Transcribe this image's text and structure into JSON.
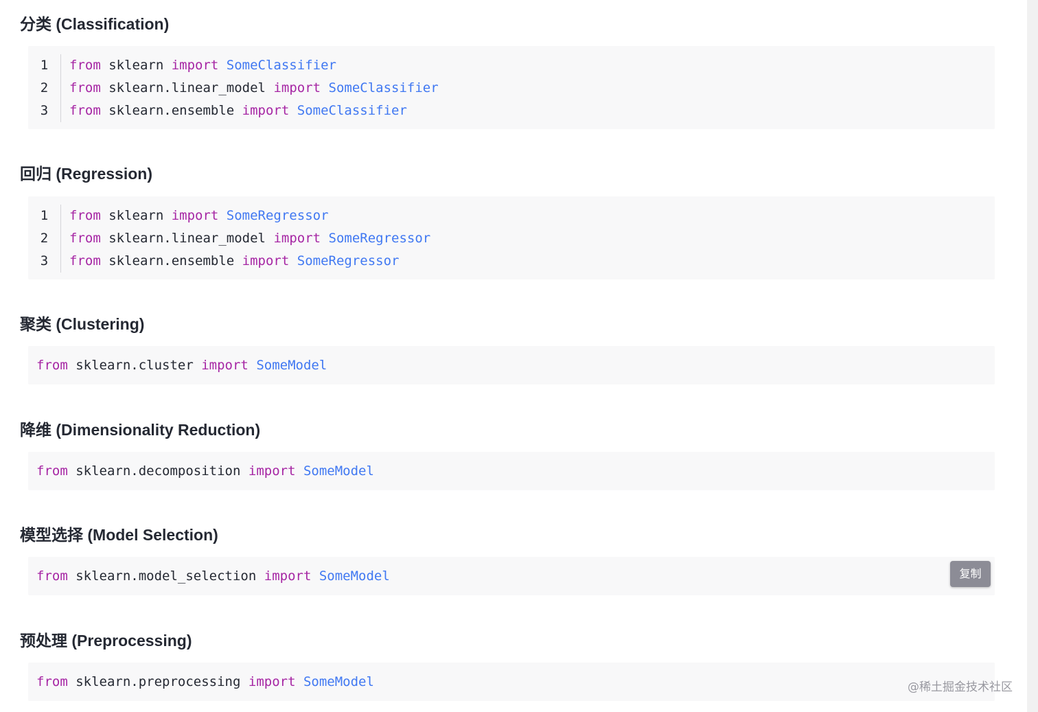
{
  "sections": [
    {
      "heading": "分类 (Classification)",
      "lines": [
        {
          "num": "1",
          "from": "from",
          "module": " sklearn ",
          "import": "import",
          "name": " SomeClassifier"
        },
        {
          "num": "2",
          "from": "from",
          "module": " sklearn.linear_model ",
          "import": "import",
          "name": " SomeClassifier"
        },
        {
          "num": "3",
          "from": "from",
          "module": " sklearn.ensemble ",
          "import": "import",
          "name": " SomeClassifier"
        }
      ]
    },
    {
      "heading": "回归 (Regression)",
      "lines": [
        {
          "num": "1",
          "from": "from",
          "module": " sklearn ",
          "import": "import",
          "name": " SomeRegressor"
        },
        {
          "num": "2",
          "from": "from",
          "module": " sklearn.linear_model ",
          "import": "import",
          "name": " SomeRegressor"
        },
        {
          "num": "3",
          "from": "from",
          "module": " sklearn.ensemble ",
          "import": "import",
          "name": " SomeRegressor"
        }
      ]
    },
    {
      "heading": "聚类 (Clustering)",
      "line": {
        "from": "from",
        "module": " sklearn.cluster ",
        "import": "import",
        "name": " SomeModel"
      }
    },
    {
      "heading": "降维 (Dimensionality Reduction)",
      "line": {
        "from": "from",
        "module": " sklearn.decomposition ",
        "import": "import",
        "name": " SomeModel"
      }
    },
    {
      "heading": "模型选择 (Model Selection)",
      "line": {
        "from": "from",
        "module": " sklearn.model_selection ",
        "import": "import",
        "name": " SomeModel"
      },
      "copy_label": "复制"
    },
    {
      "heading": "预处理 (Preprocessing)",
      "line": {
        "from": "from",
        "module": " sklearn.preprocessing ",
        "import": "import",
        "name": " SomeModel"
      }
    }
  ],
  "watermark": "@稀土掘金技术社区",
  "colors": {
    "keyword": "#a626a4",
    "class_name": "#4078f2",
    "code_bg": "#f8f8f9",
    "copy_button_bg": "#8c8c96"
  }
}
